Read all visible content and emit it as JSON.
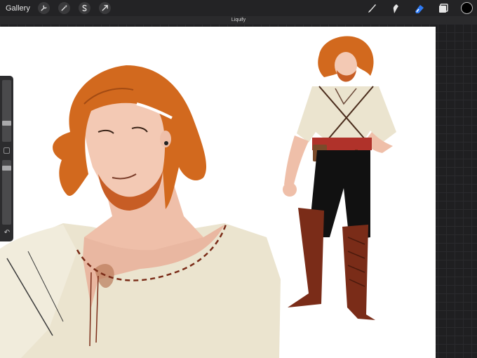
{
  "toolbar": {
    "gallery_label": "Gallery",
    "left_tools": [
      "wrench-icon",
      "magic-wand-icon",
      "selection-s-icon",
      "transform-arrow-icon"
    ],
    "right_tools": [
      "brush-icon",
      "smudge-icon",
      "eraser-icon",
      "layers-icon"
    ],
    "active_tool": "eraser-icon",
    "active_color": "#000000",
    "accent": "#2f7bf5"
  },
  "mode_banner": {
    "label": "Liquify"
  },
  "sidebar": {
    "brush_size_level": 0.68,
    "opacity_level": 0.96,
    "undo_icon": "undo-arrow-icon"
  },
  "artwork": {
    "palette": {
      "hair": "#d2691e",
      "skin": "#f3c9b4",
      "shirt": "#ebe4cf",
      "boots": "#7a2c18",
      "pants": "#111111",
      "belt": "#b0322a"
    }
  }
}
